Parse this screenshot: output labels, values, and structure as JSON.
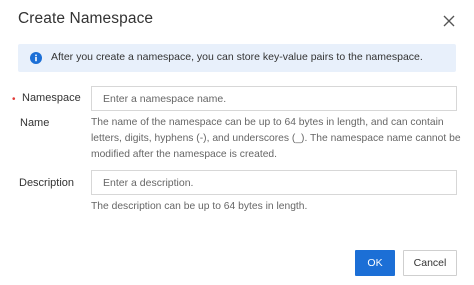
{
  "dialog": {
    "title": "Create Namespace",
    "close_icon": "close-icon"
  },
  "notice": {
    "icon": "info-icon",
    "text": "After you create a namespace, you can store key-value pairs to the namespace.",
    "background": "#e8f0fb",
    "icon_color": "#1c6fd6"
  },
  "form": {
    "namespace": {
      "required_mark": "•",
      "label_line1": "Namespace",
      "label_line2": "Name",
      "placeholder": "Enter a namespace name.",
      "value": "",
      "help": "The name of the namespace can be up to 64 bytes in length, and can contain letters, digits, hyphens (-), and underscores (_). The namespace name cannot be modified after the namespace is created."
    },
    "description": {
      "label": "Description",
      "placeholder": "Enter a description.",
      "value": "",
      "help": "The description can be up to 64 bytes in length."
    }
  },
  "footer": {
    "ok_label": "OK",
    "cancel_label": "Cancel",
    "primary_color": "#1c6fd6"
  }
}
